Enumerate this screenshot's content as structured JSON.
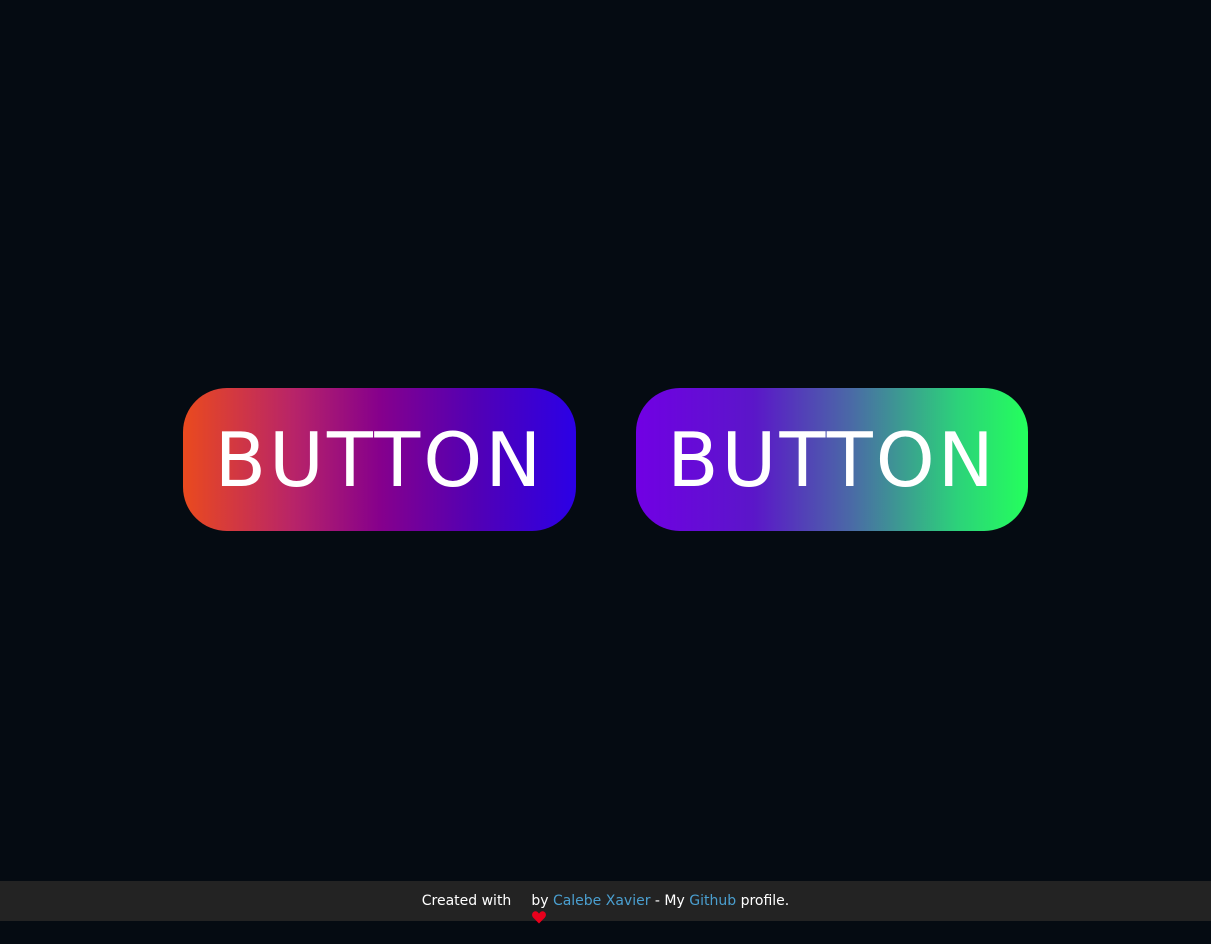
{
  "buttons": [
    {
      "label": "BUTTON",
      "gradient": [
        "#ea4a1e",
        "#86008c",
        "#2b00e6"
      ]
    },
    {
      "label": "BUTTON",
      "gradient": [
        "#7100e4",
        "#4a6aa6",
        "#24ff5c"
      ]
    }
  ],
  "footer": {
    "prefix": "Created with",
    "icon": "heart-icon",
    "by": "by",
    "author_link": "Calebe Xavier",
    "middle": "- My",
    "github_link": "Github",
    "suffix": "profile.",
    "link_color": "#4a9fd0",
    "heart_color": "#e8001c"
  },
  "colors": {
    "background": "#050b12",
    "footer_background": "#232323"
  }
}
